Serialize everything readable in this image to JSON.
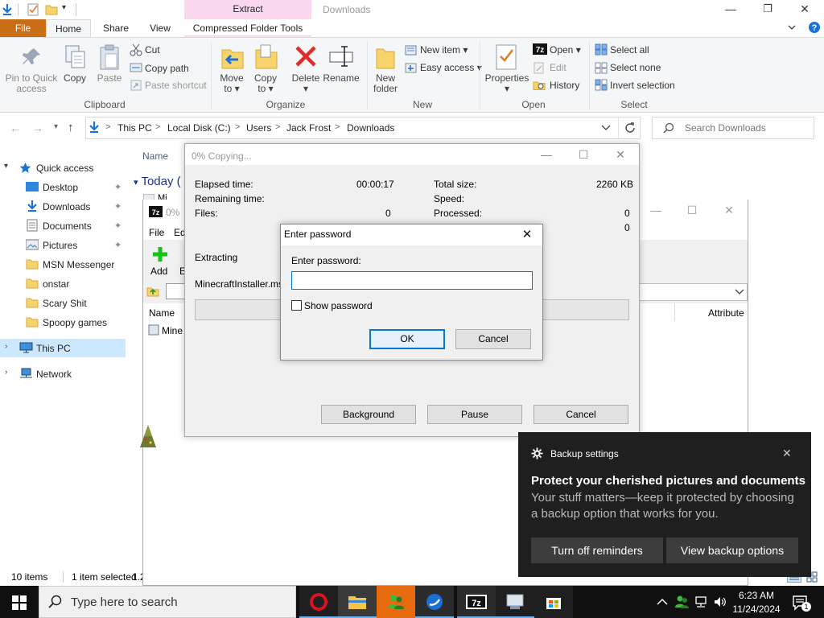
{
  "titlebar": {
    "context_tab": "Extract",
    "window_title": "Downloads",
    "minimize": "—",
    "maximize": "❐",
    "close": "✕"
  },
  "ribbon": {
    "tabs": {
      "file": "File",
      "home": "Home",
      "share": "Share",
      "view": "View",
      "compressed": "Compressed Folder Tools"
    },
    "clipboard": {
      "pin_line1": "Pin to Quick",
      "pin_line2": "access",
      "copy": "Copy",
      "paste": "Paste",
      "cut": "Cut",
      "copy_path": "Copy path",
      "paste_shortcut": "Paste shortcut",
      "group": "Clipboard"
    },
    "organize": {
      "move_to_line1": "Move",
      "move_to_line2": "to ▾",
      "copy_to_line1": "Copy",
      "copy_to_line2": "to ▾",
      "delete_line1": "Delete",
      "delete_line2": "▾",
      "rename": "Rename",
      "group": "Organize"
    },
    "new": {
      "new_folder_line1": "New",
      "new_folder_line2": "folder",
      "new_item": "New item ▾",
      "easy_access": "Easy access ▾",
      "group": "New"
    },
    "open": {
      "properties_line1": "Properties",
      "properties_line2": "▾",
      "open": "Open ▾",
      "edit": "Edit",
      "history": "History",
      "group": "Open"
    },
    "select": {
      "select_all": "Select all",
      "select_none": "Select none",
      "invert_selection": "Invert selection",
      "group": "Select"
    }
  },
  "address": {
    "crumbs": [
      "This PC",
      "Local Disk (C:)",
      "Users",
      "Jack Frost",
      "Downloads"
    ],
    "separator": ">",
    "search_placeholder": "Search Downloads"
  },
  "nav": {
    "quick_access": "Quick access",
    "items": [
      {
        "label": "Desktop",
        "pinned": true
      },
      {
        "label": "Downloads",
        "pinned": true
      },
      {
        "label": "Documents",
        "pinned": true
      },
      {
        "label": "Pictures",
        "pinned": true
      },
      {
        "label": "MSN Messenger",
        "pinned": false
      },
      {
        "label": "onstar",
        "pinned": false
      },
      {
        "label": "Scary Shit",
        "pinned": false
      },
      {
        "label": "Spoopy games",
        "pinned": false
      }
    ],
    "this_pc": "This PC",
    "network": "Network"
  },
  "filelist": {
    "col_name": "Name",
    "group_today": "Today (",
    "partial_item": "Mi"
  },
  "statusbar": {
    "items": "10 items",
    "selected": "1 item selected",
    "size_partial": "1.2"
  },
  "zipwin": {
    "title_partial": "0%",
    "menu_file": "File",
    "menu_edit_partial": "Ed",
    "add": "Add",
    "extract_partial": "E",
    "col_name": "Name",
    "col_attributes": "Attribute",
    "row_partial": "Mine",
    "minimize": "—",
    "maximize": "☐",
    "close": "✕"
  },
  "copywin": {
    "title": "0% Copying...",
    "elapsed_label": "Elapsed time:",
    "elapsed_value": "00:00:17",
    "remaining_label": "Remaining time:",
    "files_label": "Files:",
    "files_value": "0",
    "total_size_label": "Total size:",
    "total_size_value": "2260 KB",
    "speed_label": "Speed:",
    "processed_label": "Processed:",
    "processed_value": "0",
    "extra_value": "0",
    "extracting_label": "Extracting",
    "filename": "MinecraftInstaller.msi",
    "progress": 0,
    "background_btn": "Background",
    "pause_btn": "Pause",
    "cancel_btn": "Cancel",
    "minimize": "—",
    "maximize": "☐",
    "close": "✕"
  },
  "password_dialog": {
    "title": "Enter password",
    "prompt": "Enter password:",
    "value": "",
    "show_password": "Show password",
    "ok": "OK",
    "cancel": "Cancel",
    "close": "✕"
  },
  "toast": {
    "app": "Backup settings",
    "headline": "Protect your cherished pictures and documents",
    "body": "Your stuff matters—keep it protected by choosing a backup option that works for you.",
    "turn_off": "Turn off reminders",
    "view_options": "View backup options",
    "close": "✕"
  },
  "taskbar": {
    "search_placeholder": "Type here to search",
    "time": "6:23 AM",
    "date": "11/24/2024",
    "notification_count": "1"
  },
  "colors": {
    "file_tab": "#c96e17",
    "context_tab": "#f9d8ee",
    "accent": "#0078d7",
    "selected_nav": "#cce8ff",
    "toast_bg": "#1f1f1f"
  }
}
